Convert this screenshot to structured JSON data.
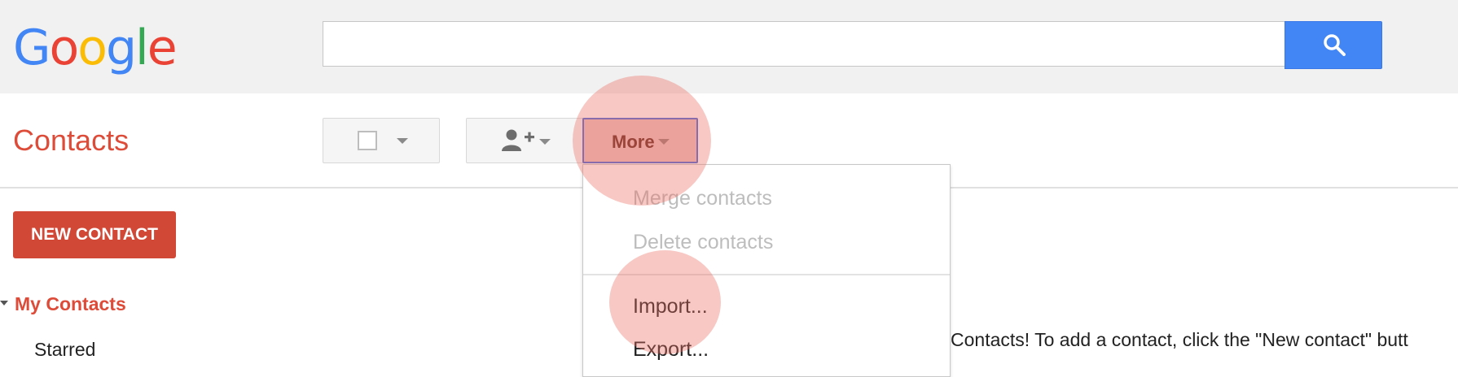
{
  "header": {
    "logo_letters": [
      {
        "char": "G",
        "color": "#4285f4"
      },
      {
        "char": "o",
        "color": "#ea4335"
      },
      {
        "char": "o",
        "color": "#fbbc05"
      },
      {
        "char": "g",
        "color": "#4285f4"
      },
      {
        "char": "l",
        "color": "#34a853"
      },
      {
        "char": "e",
        "color": "#ea4335"
      }
    ],
    "search": {
      "value": "",
      "placeholder": ""
    },
    "search_button_icon": "search-icon"
  },
  "app": {
    "title": "Contacts"
  },
  "toolbar": {
    "select_icon": "checkbox-icon",
    "add_to_group_icon": "add-person-icon",
    "more_label": "More"
  },
  "more_menu": {
    "items": [
      {
        "label": "Merge contacts",
        "enabled": false
      },
      {
        "label": "Delete contacts",
        "enabled": false
      },
      {
        "label": "Import...",
        "enabled": true
      },
      {
        "label": "Export...",
        "enabled": true
      }
    ]
  },
  "sidebar": {
    "new_contact_label": "NEW CONTACT",
    "section_label": "My Contacts",
    "items": [
      {
        "label": "Starred"
      }
    ]
  },
  "main": {
    "empty_message": "Contacts! To add a contact, click the \"New contact\" butt"
  },
  "colors": {
    "brand_red": "#dd4b39",
    "button_red": "#d14836",
    "search_blue": "#4285f4",
    "highlight": "#eb6e64"
  }
}
